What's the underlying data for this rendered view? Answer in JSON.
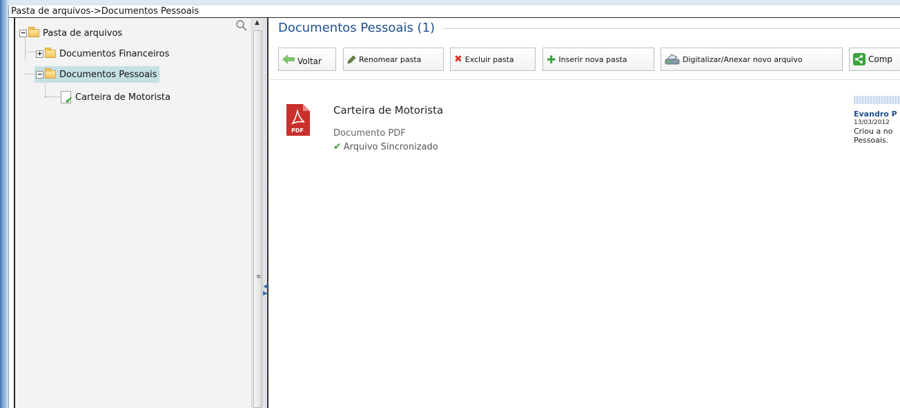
{
  "breadcrumb": "Pasta de arquivos->Documentos Pessoais",
  "tree": {
    "root": {
      "label": "Pasta de arquivos",
      "expander": "−"
    },
    "items": [
      {
        "label": "Documentos Financeiros",
        "expander": "+"
      },
      {
        "label": "Documentos Pessoais",
        "expander": "−",
        "selected": true
      }
    ],
    "file": {
      "label": "Carteira de Motorista"
    }
  },
  "panel": {
    "title": "Documentos Pessoais (1)"
  },
  "toolbar": {
    "back": "Voltar",
    "rename": "Renomear pasta",
    "delete": "Excluir pasta",
    "insert": "Inserir nova pasta",
    "scan": "Digitalizar/Anexar novo arquivo",
    "share": "Comp"
  },
  "file": {
    "name": "Carteira de Motorista",
    "type": "Documento PDF",
    "status": "Arquivo Sincronizado",
    "icon_text": "PDF"
  },
  "activity": {
    "user": "Evandro P",
    "date": "13/03/2012",
    "description_line1": "Criou a no",
    "description_line2": "Pessoais."
  },
  "colors": {
    "accent": "#1f4e8c",
    "selection": "#c5e0e2",
    "pdf_red": "#c9302c",
    "success": "#3aa53a"
  }
}
